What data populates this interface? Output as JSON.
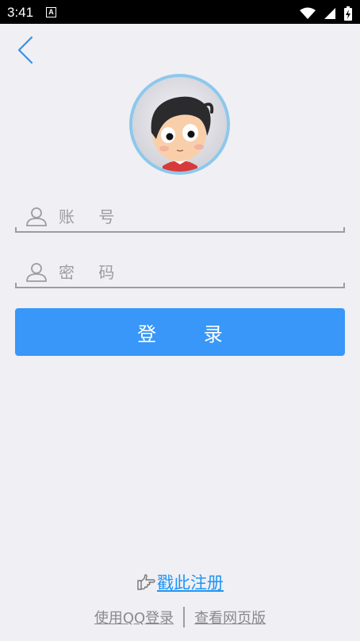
{
  "status_bar": {
    "time": "3:41",
    "notification_icon": "A",
    "icons": [
      "wifi-icon",
      "signal-icon",
      "battery-charging-icon"
    ]
  },
  "nav": {
    "back_icon": "chevron-left-icon"
  },
  "avatar": {
    "image": "cartoon-boy-avatar"
  },
  "form": {
    "account_placeholder": "账 号",
    "account_value": "",
    "password_placeholder": "密 码",
    "password_value": "",
    "field_icon": "user-icon",
    "login_label": "登 录"
  },
  "footer": {
    "register_label": "戳此注册",
    "hand_icon": "pointing-hand-icon",
    "qq_login_label": "使用QQ登录",
    "web_version_label": "查看网页版"
  },
  "colors": {
    "background": "#efeff4",
    "primary": "#3897f8",
    "link": "#1f95f4",
    "avatar_border": "#8cc8ec"
  }
}
